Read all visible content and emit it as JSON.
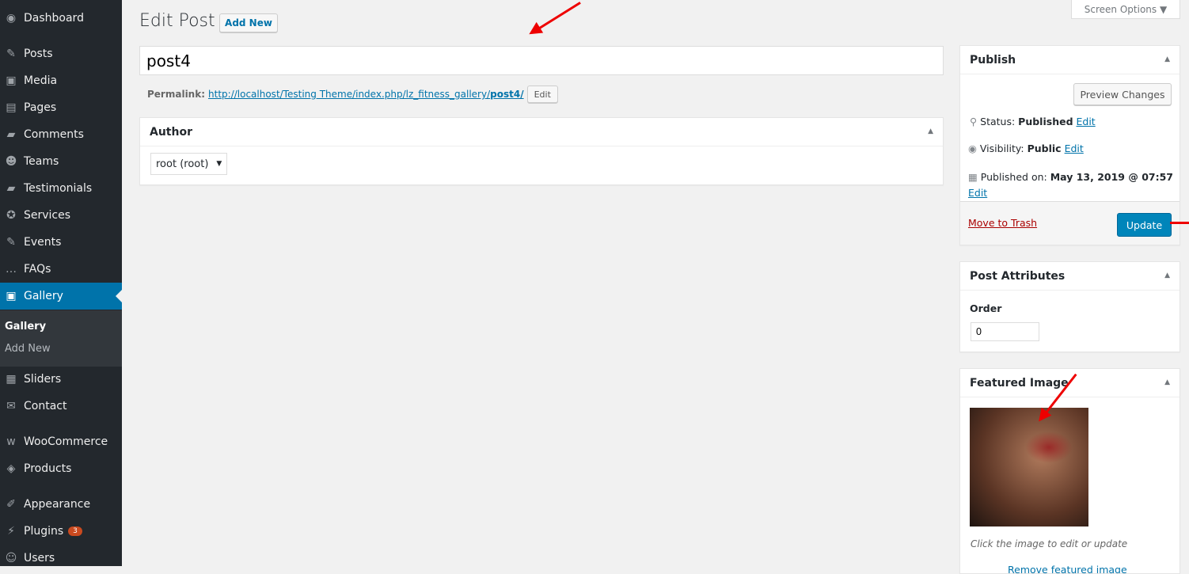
{
  "sidebar": {
    "items": [
      {
        "label": "Dashboard",
        "icon": "dashboard-icon",
        "glyph": "◉"
      },
      {
        "label": "Posts",
        "icon": "pin-icon",
        "glyph": "✎"
      },
      {
        "label": "Media",
        "icon": "media-icon",
        "glyph": "▣"
      },
      {
        "label": "Pages",
        "icon": "pages-icon",
        "glyph": "▤"
      },
      {
        "label": "Comments",
        "icon": "comments-icon",
        "glyph": "▰"
      },
      {
        "label": "Teams",
        "icon": "groups-icon",
        "glyph": "☻"
      },
      {
        "label": "Testimonials",
        "icon": "testimonial-icon",
        "glyph": "▰"
      },
      {
        "label": "Services",
        "icon": "services-icon",
        "glyph": "✪"
      },
      {
        "label": "Events",
        "icon": "pin-icon",
        "glyph": "✎"
      },
      {
        "label": "FAQs",
        "icon": "faq-icon",
        "glyph": "…"
      },
      {
        "label": "Gallery",
        "icon": "gallery-icon",
        "glyph": "▣"
      },
      {
        "label": "Sliders",
        "icon": "sliders-icon",
        "glyph": "▦"
      },
      {
        "label": "Contact",
        "icon": "mail-icon",
        "glyph": "✉"
      },
      {
        "label": "WooCommerce",
        "icon": "woocommerce-icon",
        "glyph": "w"
      },
      {
        "label": "Products",
        "icon": "products-icon",
        "glyph": "◈"
      },
      {
        "label": "Appearance",
        "icon": "brush-icon",
        "glyph": "✐"
      },
      {
        "label": "Plugins",
        "icon": "plugins-icon",
        "glyph": "⚡",
        "badge": "3"
      },
      {
        "label": "Users",
        "icon": "users-icon",
        "glyph": "☺"
      }
    ],
    "submenu": [
      "Gallery",
      "Add New"
    ]
  },
  "header": {
    "title": "Edit Post",
    "add_new": "Add New",
    "screen_options": "Screen Options ▼"
  },
  "post": {
    "title": "post4",
    "permalink_label": "Permalink:",
    "permalink_base": "http://localhost/Testing Theme/index.php/lz_fitness_gallery/",
    "permalink_slug": "post4/",
    "edit": "Edit"
  },
  "author": {
    "title": "Author",
    "value": "root (root)"
  },
  "publish": {
    "title": "Publish",
    "preview": "Preview Changes",
    "status_label": "Status:",
    "status": "Published",
    "visibility_label": "Visibility:",
    "visibility": "Public",
    "published_label": "Published on:",
    "published": "May 13, 2019 @ 07:57",
    "edit": "Edit",
    "trash": "Move to Trash",
    "update": "Update"
  },
  "attributes": {
    "title": "Post Attributes",
    "order_label": "Order",
    "order": "0"
  },
  "featured": {
    "title": "Featured Image",
    "hint": "Click the image to edit or update",
    "remove": "Remove featured image"
  },
  "colors": {
    "accent": "#0073aa",
    "sidebar": "#23282d",
    "trash": "#a00",
    "annotation_arrow": "#ee0000"
  }
}
